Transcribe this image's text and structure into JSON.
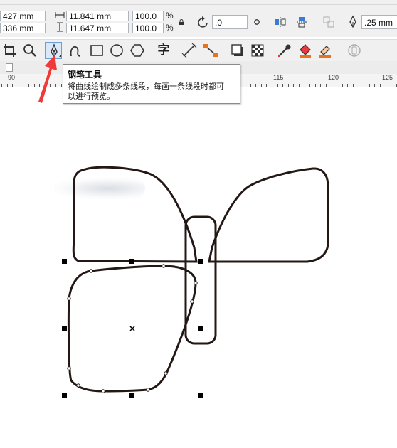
{
  "property_bar": {
    "pos_x": "427 mm",
    "pos_y": "336 mm",
    "width": "11.841 mm",
    "height": "11.647 mm",
    "scale_x": "100.0",
    "scale_y": "100.0",
    "percent_x": "%",
    "percent_y": "%",
    "rotation": ".0",
    "outline_width": ".25 mm"
  },
  "toolbox": {
    "items": [
      {
        "name": "crop-tool-icon"
      },
      {
        "name": "zoom-tool-icon"
      },
      {
        "name": "pen-tool-icon",
        "selected": true
      },
      {
        "name": "artistic-media-tool-icon"
      },
      {
        "name": "rectangle-tool-icon"
      },
      {
        "name": "ellipse-tool-icon"
      },
      {
        "name": "polygon-tool-icon"
      },
      {
        "name": "text-tool-icon"
      },
      {
        "name": "dimension-tool-icon"
      },
      {
        "name": "connector-tool-icon"
      },
      {
        "name": "drop-shadow-tool-icon"
      },
      {
        "name": "transparency-tool-icon"
      },
      {
        "name": "eyedropper-tool-icon"
      },
      {
        "name": "interactive-fill-tool-icon"
      },
      {
        "name": "smart-fill-tool-icon"
      },
      {
        "name": "outline-tool-icon"
      }
    ],
    "text_tool_glyph": "字"
  },
  "ruler": {
    "labels": [
      "90",
      "115",
      "120",
      "125"
    ]
  },
  "tooltip": {
    "title": "钢笔工具",
    "line1": "将曲线绘制成多条线段，每画一条线段时都可",
    "line2": "以进行预览。"
  },
  "colors": {
    "arrow": "#f03a3a",
    "selection": "#6b9dd6",
    "shape_stroke": "#231815"
  }
}
